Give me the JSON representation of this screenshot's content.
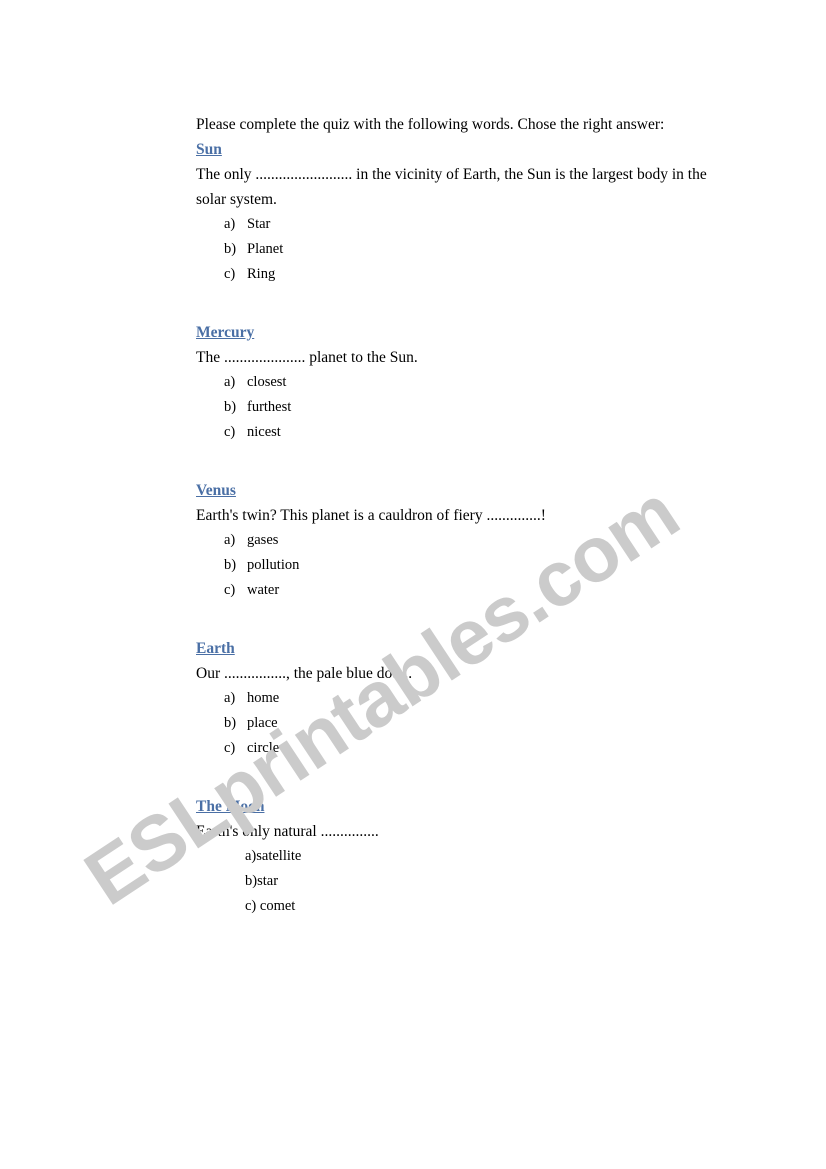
{
  "document": {
    "intro": "Please complete the quiz with the following words. Chose the right answer:",
    "watermark": "ESLprintables.com",
    "heading_color": "#4a6fa5",
    "watermark_color": "#cbcbcb",
    "sections": [
      {
        "heading": "Sun",
        "question": "The only ......................... in the vicinity of Earth, the Sun is the largest body in the solar system.",
        "options": [
          {
            "letter": "a)",
            "text": "Star"
          },
          {
            "letter": "b)",
            "text": "Planet"
          },
          {
            "letter": "c)",
            "text": "Ring"
          }
        ]
      },
      {
        "heading": "Mercury",
        "question": "The ..................... planet to the Sun.",
        "options": [
          {
            "letter": "a)",
            "text": "closest"
          },
          {
            "letter": "b)",
            "text": "furthest"
          },
          {
            "letter": "c)",
            "text": "nicest"
          }
        ]
      },
      {
        "heading": "Venus",
        "question": "Earth's twin? This planet is a cauldron of fiery ..............!",
        "options": [
          {
            "letter": "a)",
            "text": "gases"
          },
          {
            "letter": "b)",
            "text": "pollution"
          },
          {
            "letter": "c)",
            "text": "water"
          }
        ]
      },
      {
        "heading": "Earth",
        "question": "Our ................, the pale blue dot ...",
        "options": [
          {
            "letter": "a)",
            "text": "home"
          },
          {
            "letter": "b)",
            "text": "place"
          },
          {
            "letter": "c)",
            "text": "circle"
          }
        ]
      },
      {
        "heading": "The Moon",
        "question": "Earth's only natural ...............",
        "indented": true,
        "options": [
          {
            "letter": "a)",
            "text": "satellite"
          },
          {
            "letter": "b)",
            "text": "star"
          },
          {
            "letter": "c)",
            "text": " comet"
          }
        ]
      }
    ]
  }
}
